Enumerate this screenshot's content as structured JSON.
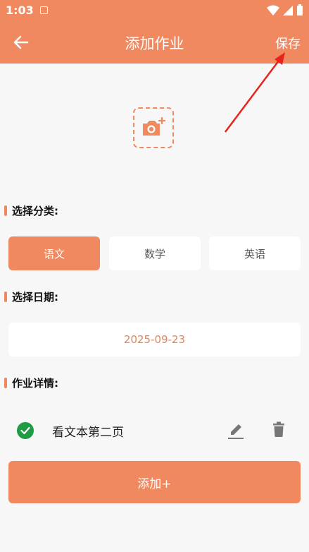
{
  "status_bar": {
    "time": "1:03"
  },
  "app_bar": {
    "title": "添加作业",
    "save_label": "保存"
  },
  "category": {
    "label": "选择分类:",
    "options": [
      {
        "label": "语文",
        "selected": true
      },
      {
        "label": "数学",
        "selected": false
      },
      {
        "label": "英语",
        "selected": false
      }
    ]
  },
  "date": {
    "label": "选择日期:",
    "value": "2025-09-23"
  },
  "details": {
    "label": "作业详情:",
    "items": [
      {
        "text": "看文本第二页",
        "done": true
      }
    ]
  },
  "add_button": {
    "label": "添加+"
  },
  "colors": {
    "accent": "#f0895f",
    "check": "#1f9b45",
    "annotation_arrow": "#e8231c"
  }
}
